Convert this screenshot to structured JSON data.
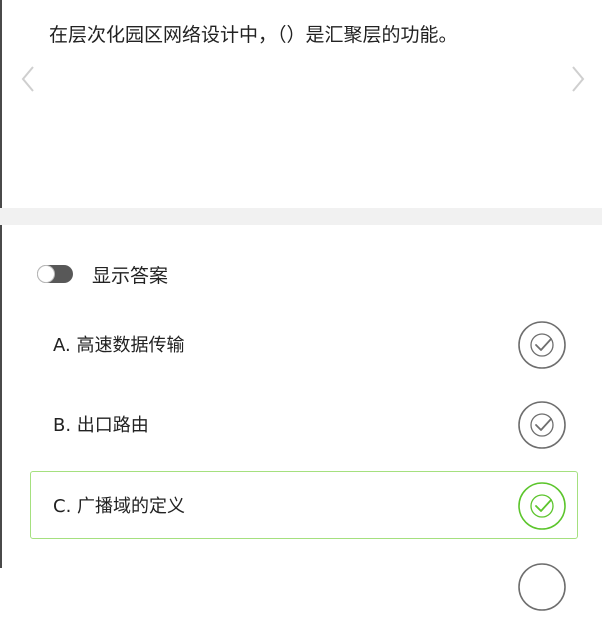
{
  "question": {
    "text": "在层次化园区网络设计中，（）是汇聚层的功能。"
  },
  "toggle": {
    "label": "显示答案",
    "on": false
  },
  "options": [
    {
      "text": "A. 高速数据传输",
      "correct": false
    },
    {
      "text": "B. 出口路由",
      "correct": false
    },
    {
      "text": "C. 广播域的定义",
      "correct": true
    }
  ],
  "colors": {
    "correct": "#5cc52c",
    "neutral": "#6e6e6e"
  }
}
